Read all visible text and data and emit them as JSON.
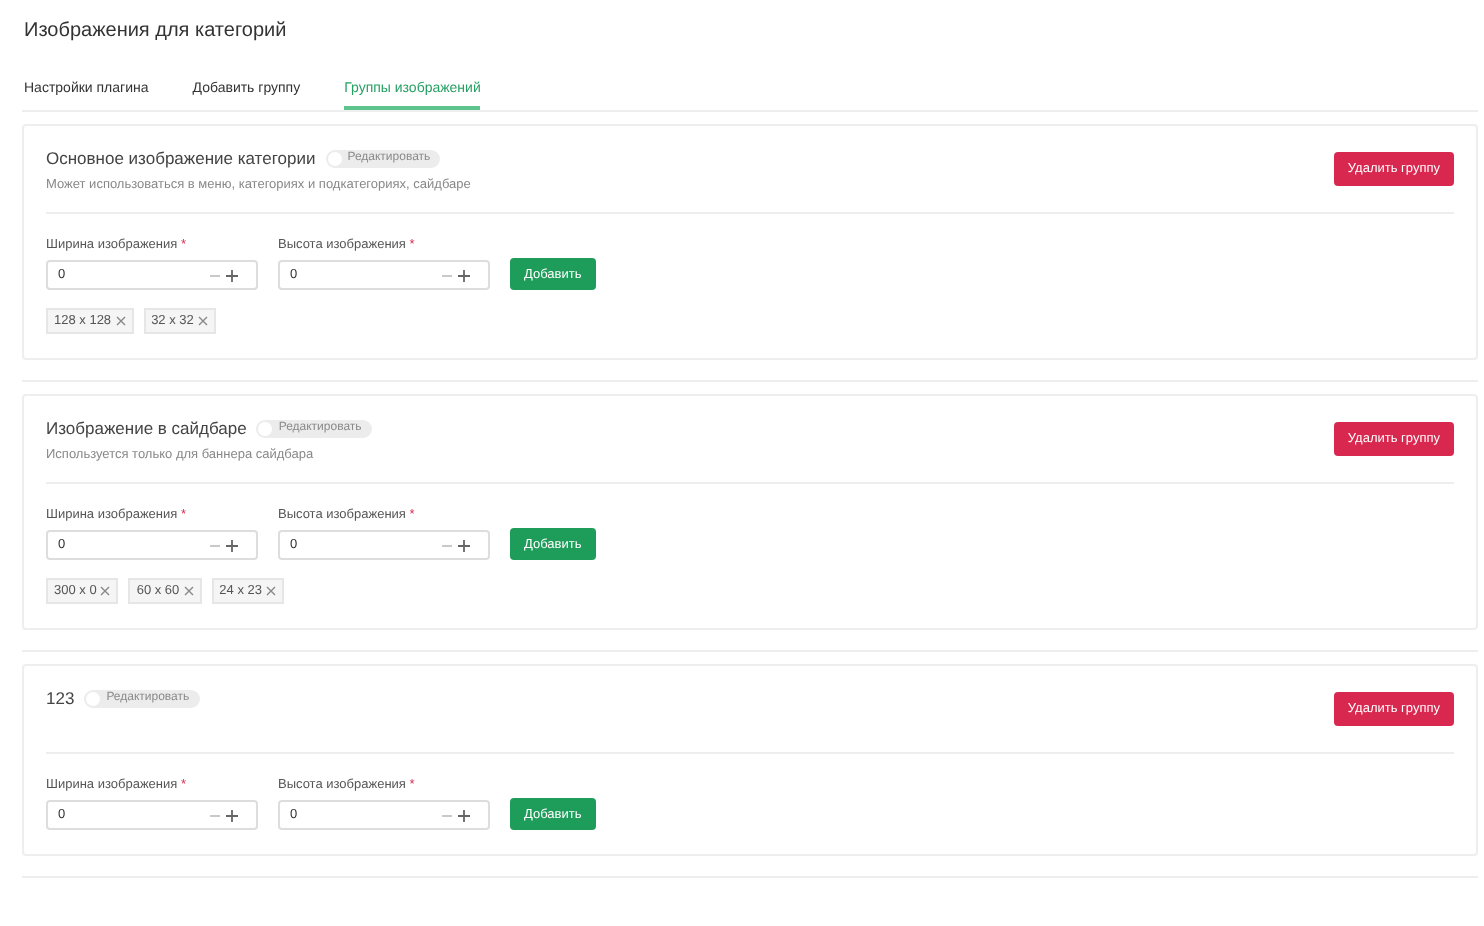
{
  "page_title": "Изображения для категорий",
  "tabs": [
    {
      "label": "Настройки плагина",
      "selected": false
    },
    {
      "label": "Добавить группу",
      "selected": false
    },
    {
      "label": "Группы изображений",
      "selected": true
    }
  ],
  "groups": [
    {
      "title": "Основное изображение категории",
      "edit_toggle": {
        "label": "Редактировать",
        "on": false
      },
      "description": "Может использоваться в меню, категориях и подкатегориях, сайдбаре",
      "delete_button": "Удалить группу",
      "fields": [
        {
          "label": "Ширина изображения",
          "required_mark": "*",
          "value": "0"
        },
        {
          "label": "Высота изображения",
          "required_mark": "*",
          "value": "0"
        }
      ],
      "add_button": "Добавить",
      "sizes": [
        "128 x 128",
        "32 x 32"
      ]
    },
    {
      "title": "Изображение в сайдбаре",
      "edit_toggle": {
        "label": "Редактировать",
        "on": false
      },
      "description": "Используется только для баннера сайдбара",
      "delete_button": "Удалить группу",
      "fields": [
        {
          "label": "Ширина изображения",
          "required_mark": "*",
          "value": "0"
        },
        {
          "label": "Высота изображения",
          "required_mark": "*",
          "value": "0"
        }
      ],
      "add_button": "Добавить",
      "sizes": [
        "300 x 0",
        "60 x 60",
        "24 x 23"
      ]
    },
    {
      "title": "123",
      "edit_toggle": {
        "label": "Редактировать",
        "on": false
      },
      "delete_button": "Удалить группу",
      "fields": [
        {
          "label": "Ширина изображения",
          "required_mark": "*",
          "value": "0"
        },
        {
          "label": "Высота изображения",
          "required_mark": "*",
          "value": "0"
        }
      ],
      "add_button": "Добавить"
    }
  ]
}
